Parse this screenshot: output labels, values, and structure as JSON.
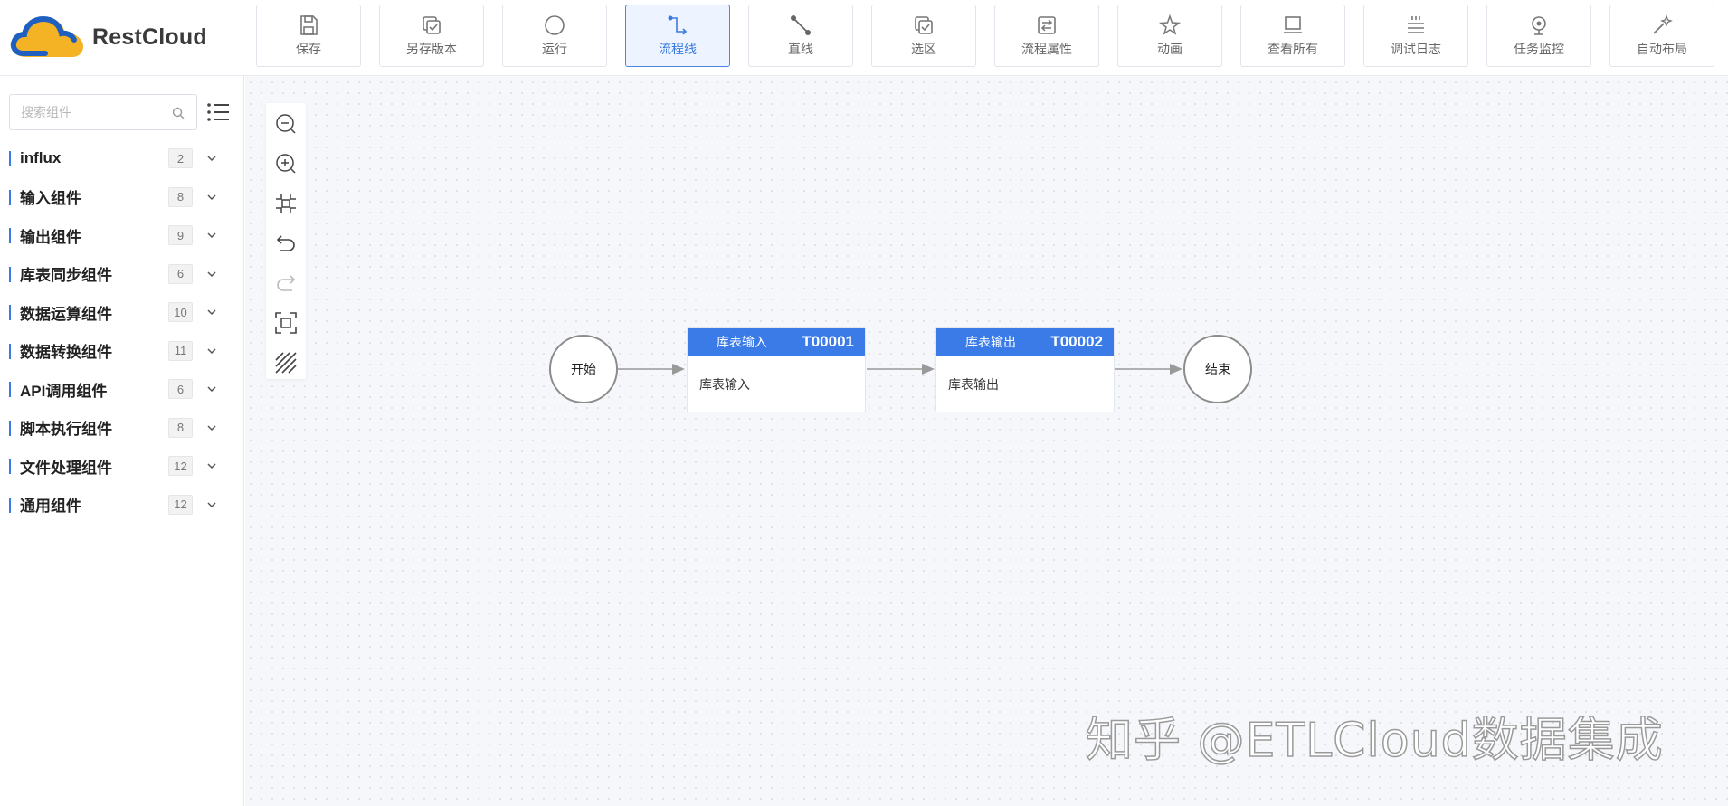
{
  "app": {
    "logo_text": "RestCloud"
  },
  "toolbar": {
    "buttons": [
      {
        "label": "保存",
        "icon": "save-icon"
      },
      {
        "label": "另存版本",
        "icon": "save-version-icon"
      },
      {
        "label": "运行",
        "icon": "run-icon"
      },
      {
        "label": "流程线",
        "icon": "flow-line-icon",
        "active": true
      },
      {
        "label": "直线",
        "icon": "straight-line-icon"
      },
      {
        "label": "选区",
        "icon": "selection-icon"
      },
      {
        "label": "流程属性",
        "icon": "flow-properties-icon"
      },
      {
        "label": "动画",
        "icon": "animation-icon"
      },
      {
        "label": "查看所有",
        "icon": "view-all-icon"
      },
      {
        "label": "调试日志",
        "icon": "debug-log-icon"
      },
      {
        "label": "任务监控",
        "icon": "task-monitor-icon"
      },
      {
        "label": "自动布局",
        "icon": "auto-layout-icon"
      }
    ],
    "accent_color": "#3a7be0"
  },
  "sidebar": {
    "search": {
      "placeholder": "搜索组件",
      "value": ""
    },
    "groups": [
      {
        "name": "influx",
        "count": "2"
      },
      {
        "name": "输入组件",
        "count": "8"
      },
      {
        "name": "输出组件",
        "count": "9"
      },
      {
        "name": "库表同步组件",
        "count": "6"
      },
      {
        "name": "数据运算组件",
        "count": "10"
      },
      {
        "name": "数据转换组件",
        "count": "11"
      },
      {
        "name": "API调用组件",
        "count": "6"
      },
      {
        "name": "脚本执行组件",
        "count": "8"
      },
      {
        "name": "文件处理组件",
        "count": "12"
      },
      {
        "name": "通用组件",
        "count": "12"
      }
    ]
  },
  "canvas": {
    "controls": [
      "zoom-out-icon",
      "zoom-in-icon",
      "fit-view-icon",
      "undo-icon",
      "redo-icon",
      "fullscreen-icon",
      "grid-toggle-icon"
    ],
    "nodes": {
      "start": {
        "label": "开始"
      },
      "task1": {
        "name": "库表输入",
        "id": "T00001",
        "body": "库表输入"
      },
      "task2": {
        "name": "库表输出",
        "id": "T00002",
        "body": "库表输出"
      },
      "end": {
        "label": "结束"
      }
    },
    "header_color": "#3a7be8"
  },
  "watermark": {
    "text": "知乎 @ETLCloud数据集成"
  }
}
